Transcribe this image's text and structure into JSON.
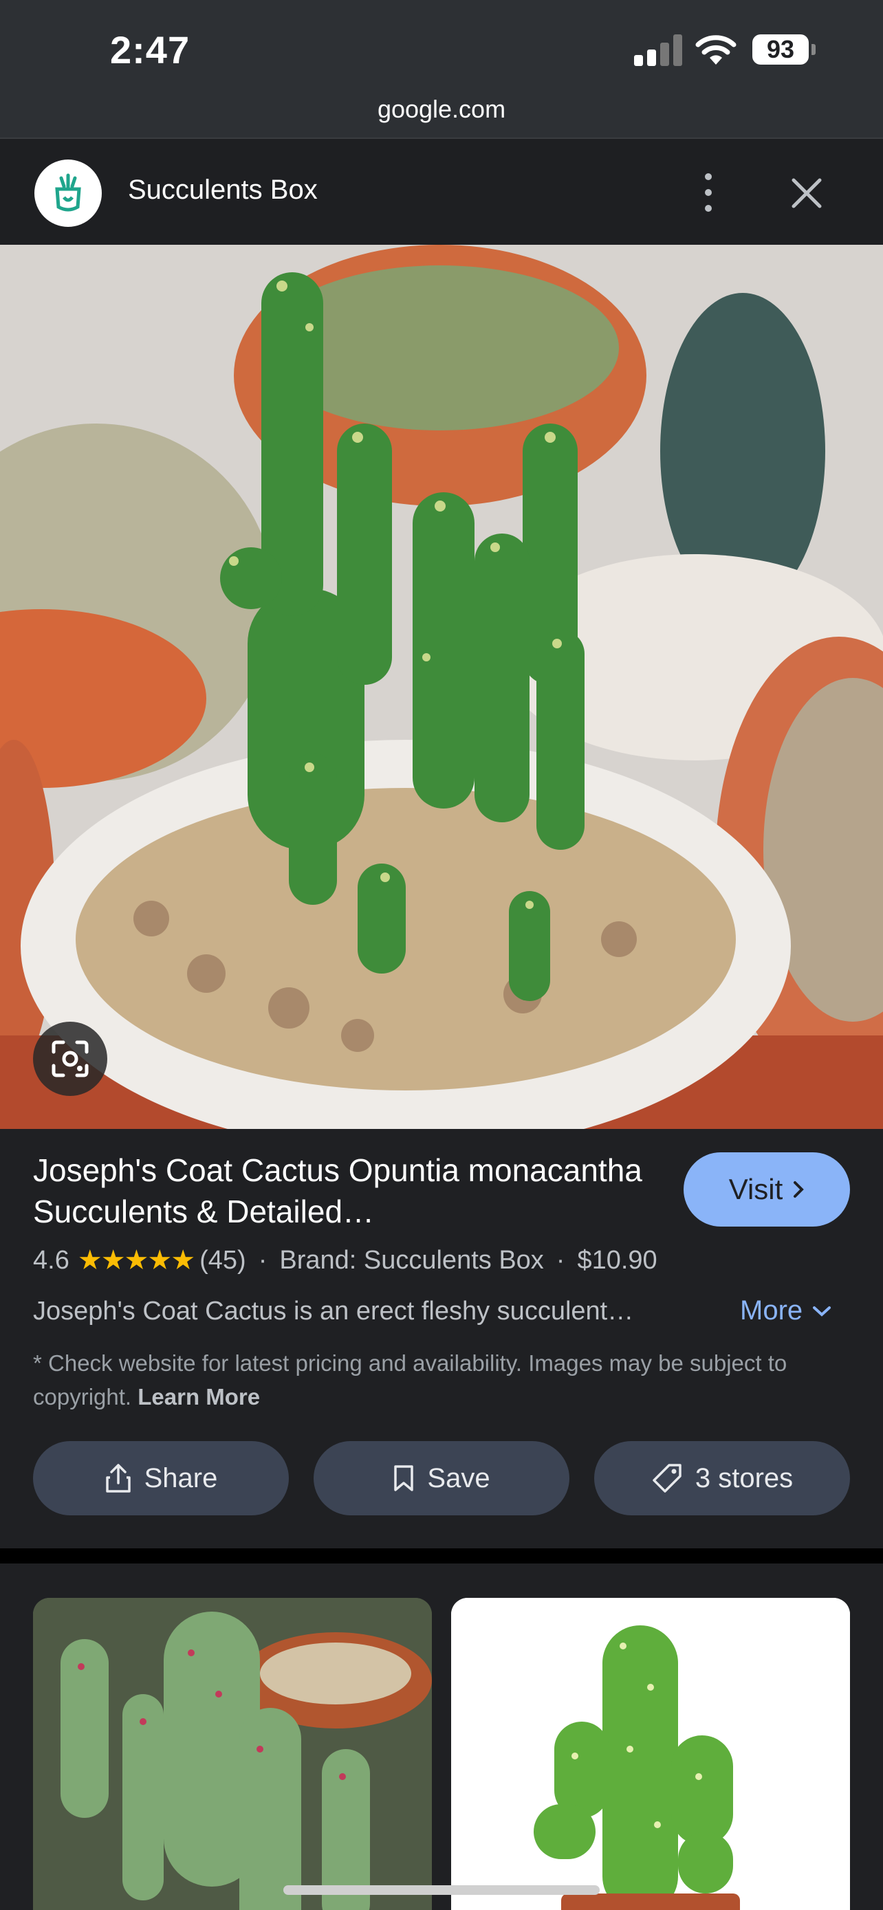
{
  "status_bar": {
    "time": "2:47",
    "battery": "93",
    "url": "google.com"
  },
  "site": {
    "name": "Succulents Box"
  },
  "product": {
    "title": "Joseph's Coat Cactus Opuntia monacantha Succulents & Detailed…",
    "visit_label": "Visit",
    "rating": "4.6",
    "stars_glyphs": "★★★★★",
    "review_count": "(45)",
    "brand": "Brand: Succulents Box",
    "price": "$10.90",
    "description": "Joseph's Coat Cactus is an erect fleshy succulent…",
    "more_label": "More",
    "disclaimer": "* Check website for latest pricing and availability. Images may be subject to copyright.",
    "learn_more": "Learn More"
  },
  "actions": {
    "share": "Share",
    "save": "Save",
    "stores": "3 stores"
  },
  "colors": {
    "accent": "#8ab4f8",
    "star": "#fbbc04",
    "chip_bg": "#3c4454",
    "background": "#1f2023"
  }
}
